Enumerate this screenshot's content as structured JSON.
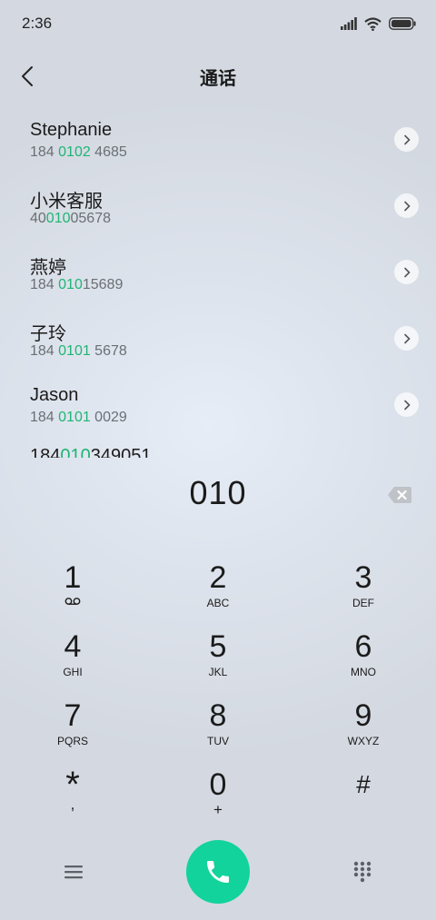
{
  "status_bar": {
    "time": "2:36"
  },
  "header": {
    "title": "通话"
  },
  "contacts": [
    {
      "name": "Stephanie",
      "number_parts": [
        "184 ",
        "0102",
        " 4685"
      ]
    },
    {
      "name": "小米客服",
      "number_parts": [
        "40",
        "010",
        "05678"
      ]
    },
    {
      "name": "燕婷",
      "number_parts": [
        "184 ",
        "010",
        "15689"
      ]
    },
    {
      "name": "子玲",
      "number_parts": [
        "184 ",
        "0101",
        " 5678"
      ]
    },
    {
      "name": "Jason",
      "number_parts": [
        "184 ",
        "0101",
        " 0029"
      ]
    }
  ],
  "partial_row": {
    "number_parts": [
      "184",
      "010",
      "349051"
    ]
  },
  "dial": {
    "entered": "010"
  },
  "keypad": {
    "keys": [
      {
        "digit": "1",
        "sub": ""
      },
      {
        "digit": "2",
        "sub": "ABC"
      },
      {
        "digit": "3",
        "sub": "DEF"
      },
      {
        "digit": "4",
        "sub": "GHI"
      },
      {
        "digit": "5",
        "sub": "JKL"
      },
      {
        "digit": "6",
        "sub": "MNO"
      },
      {
        "digit": "7",
        "sub": "PQRS"
      },
      {
        "digit": "8",
        "sub": "TUV"
      },
      {
        "digit": "9",
        "sub": "WXYZ"
      },
      {
        "digit": "*",
        "sub": ","
      },
      {
        "digit": "0",
        "sub": "+"
      },
      {
        "digit": "#",
        "sub": ""
      }
    ]
  },
  "icons": {
    "back": "chevron-left-icon",
    "backspace": "backspace-icon",
    "voicemail": "voicemail-icon",
    "menu": "menu-icon",
    "call": "phone-icon",
    "keypad_toggle": "keypad-grid-icon"
  },
  "colors": {
    "highlight": "#1fb575",
    "call_button": "#12d39b"
  }
}
